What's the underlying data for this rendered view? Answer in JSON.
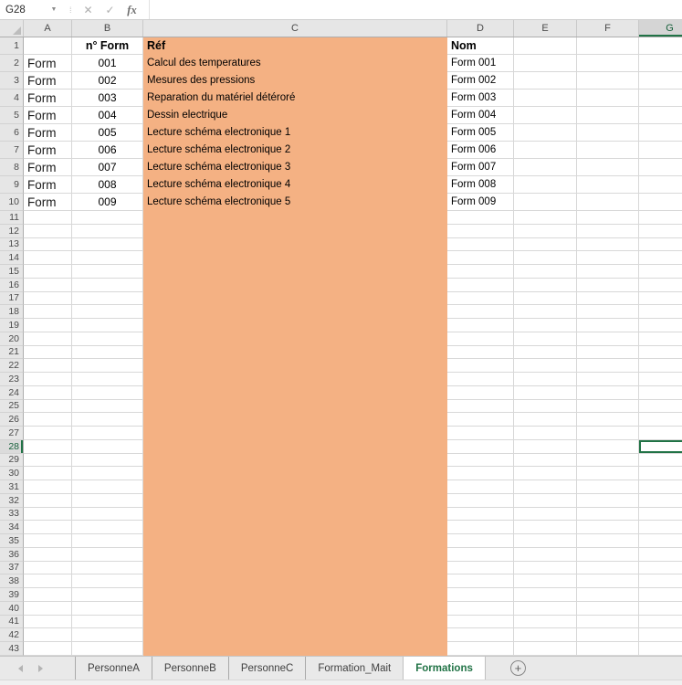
{
  "name_box": {
    "value": "G28"
  },
  "formula_bar": {
    "value": "",
    "cancel_icon": "✕",
    "enter_icon": "✓",
    "fx_icon": "fx"
  },
  "selection": {
    "cell": "G28",
    "column": "G",
    "row": 28
  },
  "grid": {
    "columns": [
      "A",
      "B",
      "C",
      "D",
      "E",
      "F",
      "G"
    ],
    "row_count": 43,
    "filled_column": "C"
  },
  "table": {
    "headers": {
      "b": "n° Form",
      "c": "Réf",
      "d": "Nom"
    },
    "rows": [
      {
        "a": "Form",
        "b": "001",
        "c": "Calcul des temperatures",
        "d": "Form 001"
      },
      {
        "a": "Form",
        "b": "002",
        "c": "Mesures des pressions",
        "d": "Form 002"
      },
      {
        "a": "Form",
        "b": "003",
        "c": "Reparation du matériel détéroré",
        "d": "Form 003"
      },
      {
        "a": "Form",
        "b": "004",
        "c": "Dessin electrique",
        "d": "Form 004"
      },
      {
        "a": "Form",
        "b": "005",
        "c": "Lecture schéma electronique 1",
        "d": "Form 005"
      },
      {
        "a": "Form",
        "b": "006",
        "c": "Lecture schéma electronique 2",
        "d": "Form 006"
      },
      {
        "a": "Form",
        "b": "007",
        "c": "Lecture schéma electronique 3",
        "d": "Form 007"
      },
      {
        "a": "Form",
        "b": "008",
        "c": "Lecture schéma electronique 4",
        "d": "Form 008"
      },
      {
        "a": "Form",
        "b": "009",
        "c": "Lecture schéma electronique 5",
        "d": "Form 009"
      }
    ]
  },
  "sheet_tabs": [
    {
      "label": "PersonneA",
      "active": false
    },
    {
      "label": "PersonneB",
      "active": false
    },
    {
      "label": "PersonneC",
      "active": false
    },
    {
      "label": "Formation_Mait",
      "active": false
    },
    {
      "label": "Formations",
      "active": true
    }
  ],
  "new_sheet_button": "+",
  "colors": {
    "accent_green": "#217346",
    "fill_orange": "#F4B183",
    "header_bg": "#E6E6E6"
  }
}
